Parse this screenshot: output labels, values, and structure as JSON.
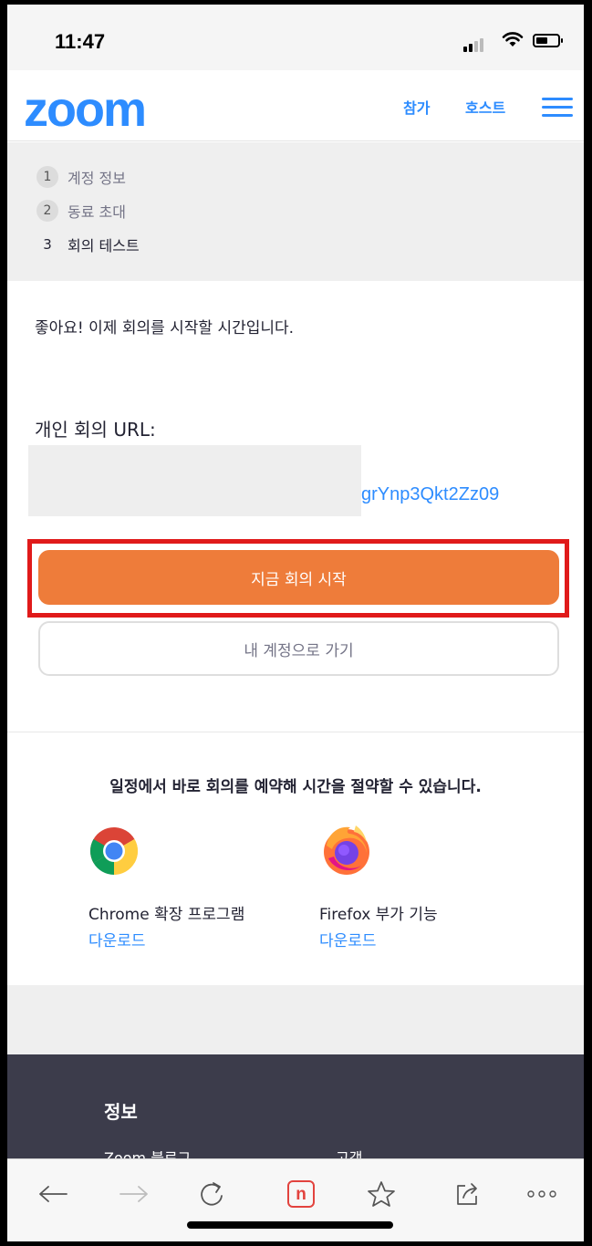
{
  "status_bar": {
    "time": "11:47"
  },
  "nav": {
    "logo": "zoom",
    "join_label": "참가",
    "host_label": "호스트"
  },
  "steps": [
    {
      "number": "1",
      "label": "계정 정보"
    },
    {
      "number": "2",
      "label": "동료 초대"
    },
    {
      "number": "3",
      "label": "회의 테스트"
    }
  ],
  "main": {
    "message": "좋아요! 이제 회의를 시작할 시간입니다.",
    "url_label": "개인 회의 URL:",
    "url_visible": "grYnp3Qkt2Zz09",
    "start_button": "지금 회의 시작",
    "account_button": "내 계정으로 가기"
  },
  "promo": {
    "text": "일정에서 바로 회의를 예약해 시간을 절약할 수 있습니다.",
    "extensions": [
      {
        "name": "Chrome 확장 프로그램",
        "link": "다운로드",
        "icon": "chrome-icon"
      },
      {
        "name": "Firefox 부가 기능",
        "link": "다운로드",
        "icon": "firefox-icon"
      }
    ]
  },
  "footer": {
    "title": "정보",
    "link1": "Zoom 블로그",
    "link2": "고객"
  },
  "toolbar": {
    "icons": [
      "back-icon",
      "forward-icon",
      "reload-icon",
      "naver-icon",
      "bookmark-star-icon",
      "share-icon",
      "more-icon"
    ],
    "naver_letter": "n"
  },
  "colors": {
    "brand_blue": "#2d8cff",
    "start_orange": "#ee7c3a",
    "highlight_red": "#e01a1a",
    "footer_dark": "#3c3c4b"
  }
}
